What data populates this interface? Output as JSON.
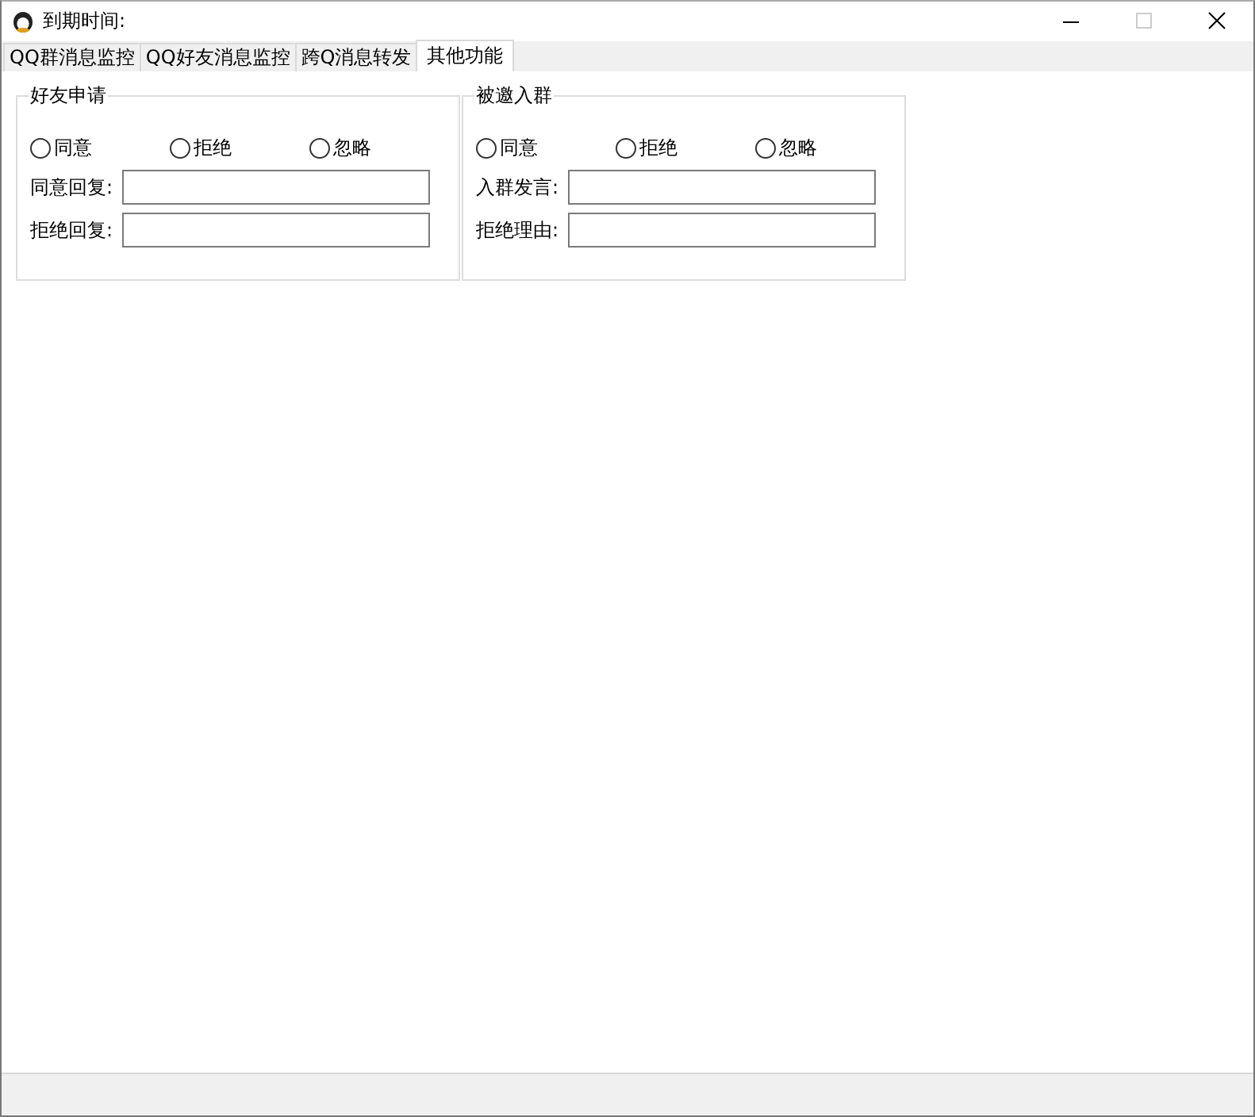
{
  "window": {
    "title": "到期时间:"
  },
  "tabs": [
    {
      "label": "QQ群消息监控",
      "selected": false
    },
    {
      "label": "QQ好友消息监控",
      "selected": false
    },
    {
      "label": "跨Q消息转发",
      "selected": false
    },
    {
      "label": "其他功能",
      "selected": true
    }
  ],
  "groups": [
    {
      "title": "好友申请",
      "options": [
        {
          "label": "同意",
          "selected": false
        },
        {
          "label": "拒绝",
          "selected": false
        },
        {
          "label": "忽略",
          "selected": false
        }
      ],
      "fields": [
        {
          "label": "同意回复:"
        },
        {
          "label": "拒绝回复:"
        }
      ]
    },
    {
      "title": "被邀入群",
      "options": [
        {
          "label": "同意",
          "selected": false
        },
        {
          "label": "拒绝",
          "selected": false
        },
        {
          "label": "忽略",
          "selected": false
        }
      ],
      "fields": [
        {
          "label": "入群发言:"
        },
        {
          "label": "拒绝理由:"
        }
      ]
    }
  ]
}
